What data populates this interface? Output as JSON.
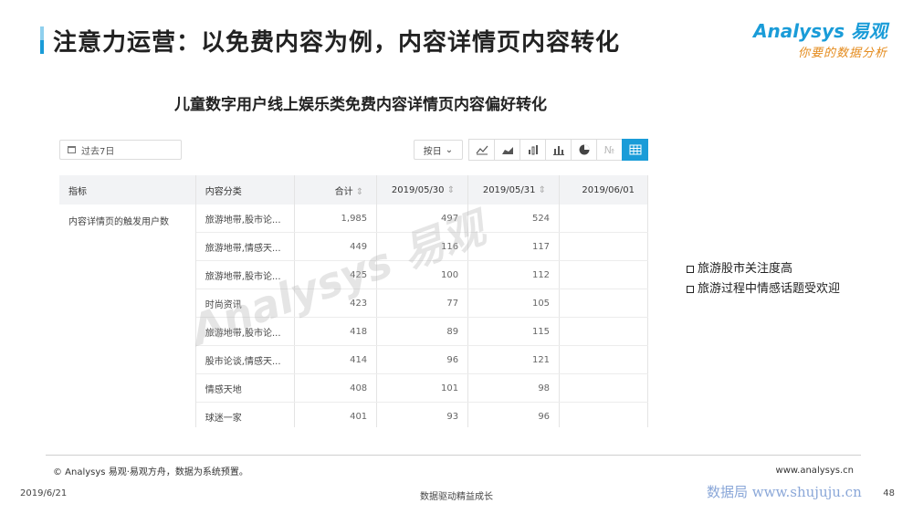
{
  "header": {
    "title": "注意力运营：以免费内容为例，内容详情页内容转化",
    "logo_main": "Analysys 易观",
    "logo_sub": "你要的数据分析"
  },
  "chart_title": "儿童数字用户线上娱乐类免费内容详情页内容偏好转化",
  "toolbar": {
    "date_range": "过去7日",
    "granularity": "按日",
    "views": [
      "line-icon",
      "area-icon",
      "stack-icon",
      "bar-icon",
      "pie-icon",
      "number-icon",
      "table-icon"
    ],
    "active_view": "table-icon"
  },
  "table": {
    "headers": [
      "指标",
      "内容分类",
      "合计",
      "2019/05/30",
      "2019/05/31",
      "2019/06/01"
    ],
    "metric": "内容详情页的触发用户数",
    "rows": [
      {
        "category": "旅游地带,股市论...",
        "total": "1,985",
        "d1": "497",
        "d2": "524"
      },
      {
        "category": "旅游地带,情感天...",
        "total": "449",
        "d1": "116",
        "d2": "117"
      },
      {
        "category": "旅游地带,股市论...",
        "total": "425",
        "d1": "100",
        "d2": "112"
      },
      {
        "category": "时尚资讯",
        "total": "423",
        "d1": "77",
        "d2": "105"
      },
      {
        "category": "旅游地带,股市论...",
        "total": "418",
        "d1": "89",
        "d2": "115"
      },
      {
        "category": "股市论谈,情感天...",
        "total": "414",
        "d1": "96",
        "d2": "121"
      },
      {
        "category": "情感天地",
        "total": "408",
        "d1": "101",
        "d2": "98"
      },
      {
        "category": "球迷一家",
        "total": "401",
        "d1": "93",
        "d2": "96"
      }
    ]
  },
  "bullets": [
    "旅游股市关注度高",
    "旅游过程中情感话题受欢迎"
  ],
  "watermark": "Analysys 易观",
  "footer": {
    "copyright": "© Analysys 易观·易观方舟，数据为系统预置。",
    "website": "www.analysys.cn",
    "date": "2019/6/21",
    "slogan": "数据驱动精益成长",
    "site_mark": "数据局  www.shujuju.cn",
    "page": "48"
  }
}
